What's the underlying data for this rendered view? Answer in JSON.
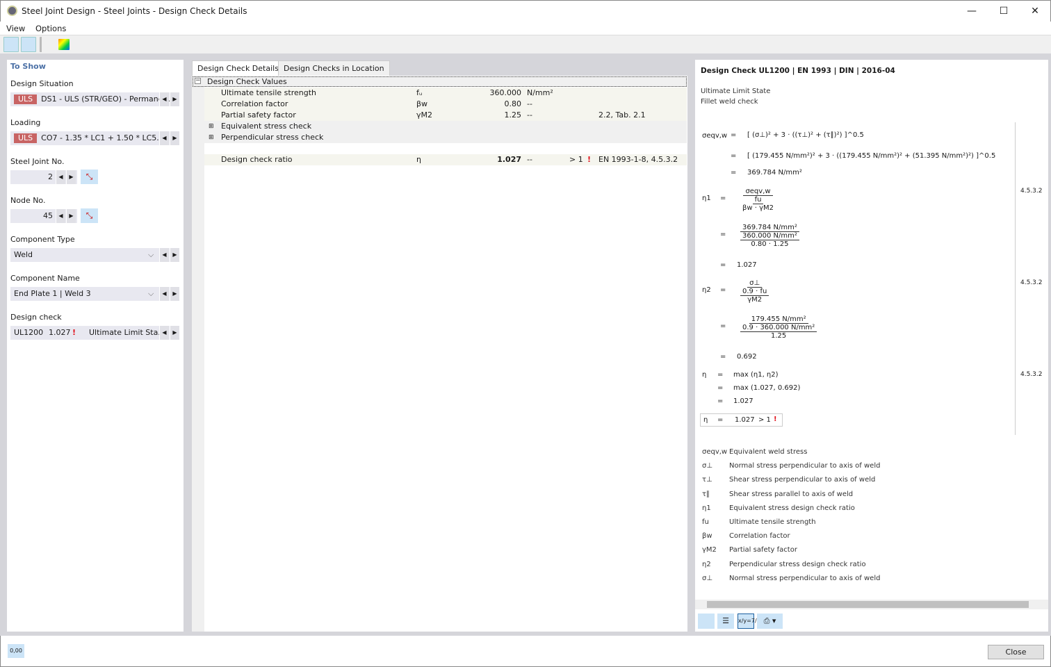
{
  "window": {
    "title": "Steel Joint Design - Steel Joints - Design Check Details",
    "minimize": "—",
    "maximize": "☐",
    "close": "✕"
  },
  "menu": [
    "View",
    "Options"
  ],
  "toolbar": {
    "icons": [
      "previous-view-icon",
      "next-view-icon",
      "table-icon",
      "result-coloring-icon"
    ]
  },
  "left": {
    "header": "To Show",
    "design_situation": {
      "label": "Design Situation",
      "badge": "ULS",
      "value": "DS1 - ULS (STR/GEO) - Permane..."
    },
    "loading": {
      "label": "Loading",
      "badge": "ULS",
      "value": "CO7 - 1.35 * LC1 + 1.50 * LC5..."
    },
    "steel_joint": {
      "label": "Steel Joint No.",
      "value": "2"
    },
    "node": {
      "label": "Node No.",
      "value": "45"
    },
    "component_type": {
      "label": "Component Type",
      "value": "Weld"
    },
    "component_name": {
      "label": "Component Name",
      "value": "End Plate 1 | Weld 3"
    },
    "design_check": {
      "label": "Design check",
      "id": "UL1200",
      "ratio": "1.027",
      "type": "Ultimate Limit Sta..."
    }
  },
  "middle": {
    "tabs": [
      "Design Check Details",
      "Design Checks in Location"
    ],
    "group": "Design Check Values",
    "rows": [
      {
        "name": "Ultimate tensile strength",
        "symbol": "fᵤ",
        "value": "360.000",
        "unit": "N/mm²",
        "cond": "",
        "ref": ""
      },
      {
        "name": "Correlation factor",
        "symbol": "βw",
        "value": "0.80",
        "unit": "--",
        "cond": "",
        "ref": ""
      },
      {
        "name": "Partial safety factor",
        "symbol": "γM2",
        "value": "1.25",
        "unit": "--",
        "cond": "",
        "ref": "2.2, Tab. 2.1"
      }
    ],
    "subgroups": [
      "Equivalent stress check",
      "Perpendicular stress check"
    ],
    "ratio": {
      "name": "Design check ratio",
      "symbol": "η",
      "value": "1.027",
      "unit": "--",
      "cond": "> 1",
      "ref": "EN 1993-1-8, 4.5.3.2"
    }
  },
  "right": {
    "title": "Design Check UL1200 | EN 1993 | DIN | 2016-04",
    "state": "Ultimate Limit State",
    "check": "Fillet weld check",
    "eqv": {
      "sym": "σeqv,w",
      "l1": "[ (σ⊥)² + 3 · ((τ⊥)² + (τ∥)²) ]^0.5",
      "l2": "[ (179.455 N/mm²)² + 3 · ((179.455 N/mm²)² + (51.395 N/mm²)²) ]^0.5",
      "l3": "369.784 N/mm²"
    },
    "eta1": {
      "sym": "η1",
      "num": "σeqv,w",
      "den_num": "fu",
      "den_den": "βw · γM2",
      "v_num": "369.784 N/mm²",
      "v_den_num": "360.000 N/mm²",
      "v_den_den": "0.80 · 1.25",
      "result": "1.027",
      "ref": "4.5.3.2"
    },
    "eta2": {
      "sym": "η2",
      "num": "σ⊥",
      "den_num": "0.9 · fu",
      "den_den": "γM2",
      "v_num": "179.455 N/mm²",
      "v_den_num": "0.9 · 360.000 N/mm²",
      "v_den_den": "1.25",
      "result": "0.692",
      "ref": "4.5.3.2"
    },
    "eta": {
      "sym": "η",
      "l1": "max (η1, η2)",
      "l2": "max (1.027, 0.692)",
      "l3": "1.027",
      "ref": "4.5.3.2"
    },
    "final": {
      "sym": "η",
      "value": "1.027",
      "cond": "> 1"
    },
    "eq": "=",
    "legend": [
      {
        "s": "σeqv,w",
        "d": "Equivalent weld stress"
      },
      {
        "s": "σ⊥",
        "d": "Normal stress perpendicular to axis of weld"
      },
      {
        "s": "τ⊥",
        "d": "Shear stress perpendicular to axis of weld"
      },
      {
        "s": "τ∥",
        "d": "Shear stress parallel to axis of weld"
      },
      {
        "s": "η1",
        "d": "Equivalent stress design check ratio"
      },
      {
        "s": "fu",
        "d": "Ultimate tensile strength"
      },
      {
        "s": "βw",
        "d": "Correlation factor"
      },
      {
        "s": "γM2",
        "d": "Partial safety factor"
      },
      {
        "s": "η2",
        "d": "Perpendicular stress design check ratio"
      },
      {
        "s": "σ⊥",
        "d": "Normal stress perpendicular to axis of weld"
      }
    ],
    "toolbar": {
      "formula_icon": "x/y=7/4"
    }
  },
  "footer": {
    "units_icon": "0,00",
    "close": "Close"
  },
  "colors": {
    "uls": "#c86464",
    "warning": "#e0101a",
    "accent": "#cce4f7"
  }
}
